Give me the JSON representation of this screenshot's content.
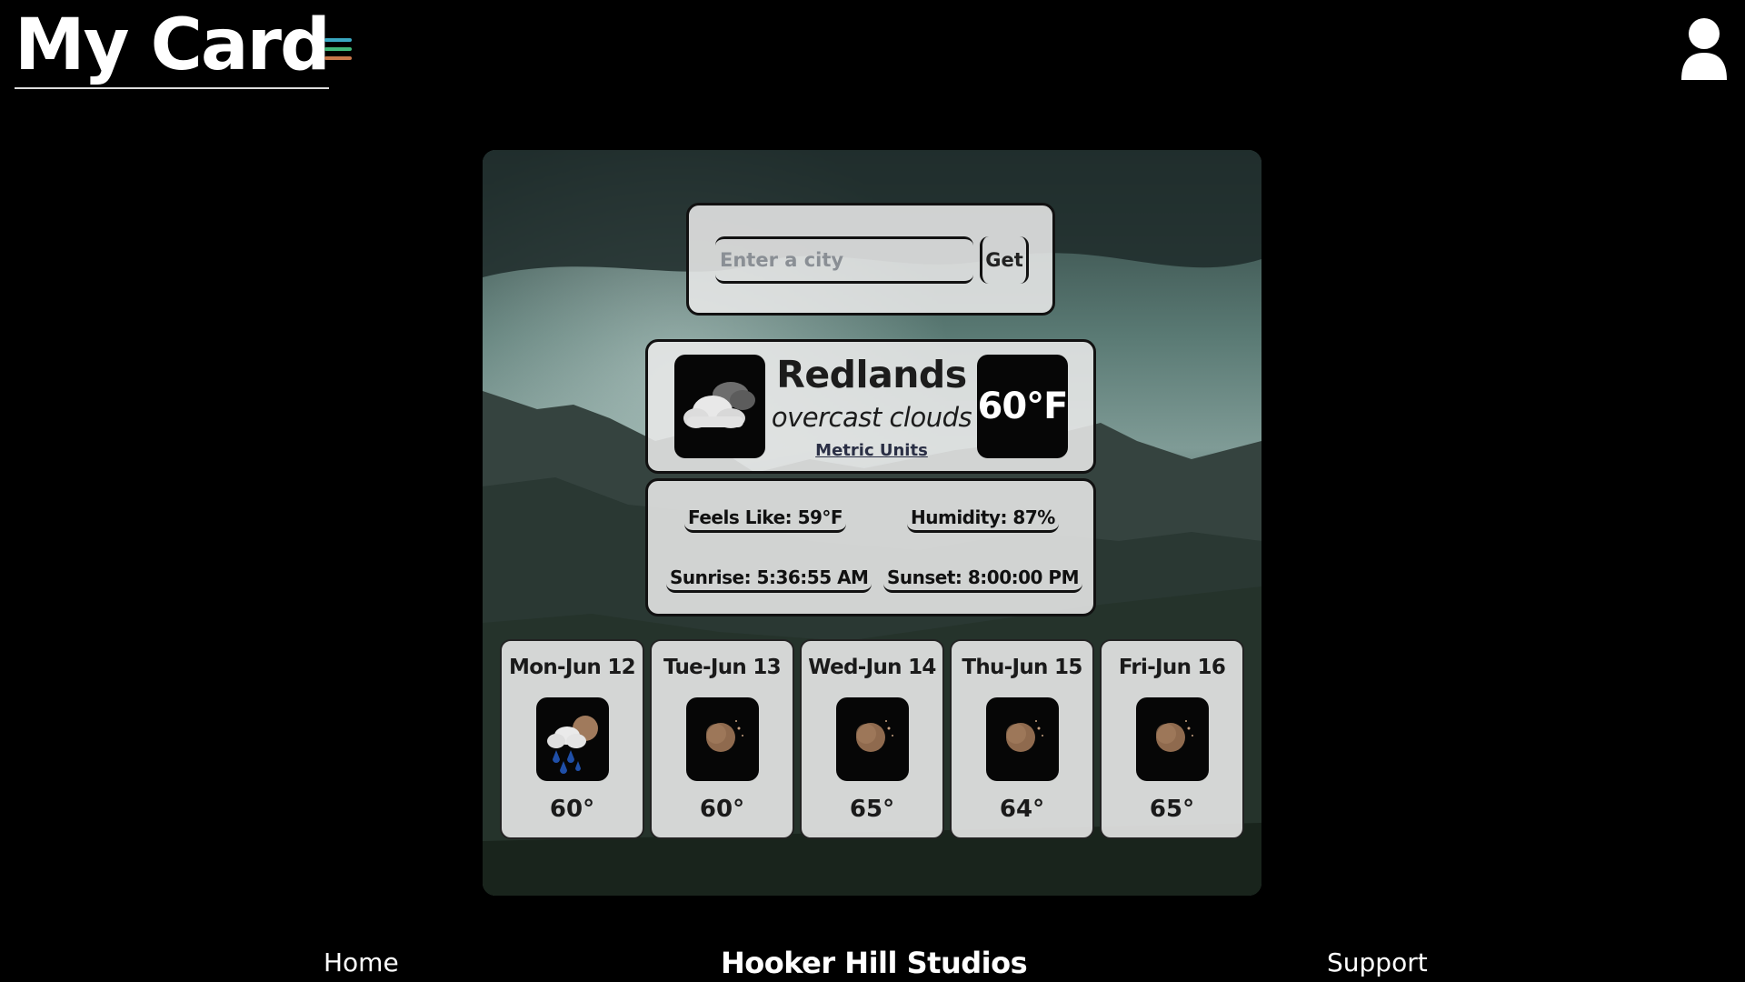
{
  "header": {
    "logo": "My Card",
    "menu_colors": [
      "#3aa8c2",
      "#41b87a",
      "#c9774a"
    ]
  },
  "weather": {
    "search": {
      "placeholder": "Enter a city",
      "button_label": "Get"
    },
    "current": {
      "city": "Redlands",
      "condition": "overcast clouds",
      "temperature": "60°F",
      "units_link": "Metric Units",
      "icon": "overcast-cloud-icon"
    },
    "details": {
      "feels_like": "Feels Like: 59°F",
      "humidity": "Humidity: 87%",
      "sunrise": "Sunrise: 5:36:55 AM",
      "sunset": "Sunset: 8:00:00 PM"
    },
    "forecast": [
      {
        "date": "Mon-Jun 12",
        "temp": "60°",
        "icon": "rain-moon-icon"
      },
      {
        "date": "Tue-Jun 13",
        "temp": "60°",
        "icon": "moon-icon"
      },
      {
        "date": "Wed-Jun 14",
        "temp": "65°",
        "icon": "moon-icon"
      },
      {
        "date": "Thu-Jun 15",
        "temp": "64°",
        "icon": "moon-icon"
      },
      {
        "date": "Fri-Jun 16",
        "temp": "65°",
        "icon": "moon-icon"
      }
    ]
  },
  "footer": {
    "home": "Home",
    "studio": "Hooker Hill Studios",
    "support": "Support"
  }
}
